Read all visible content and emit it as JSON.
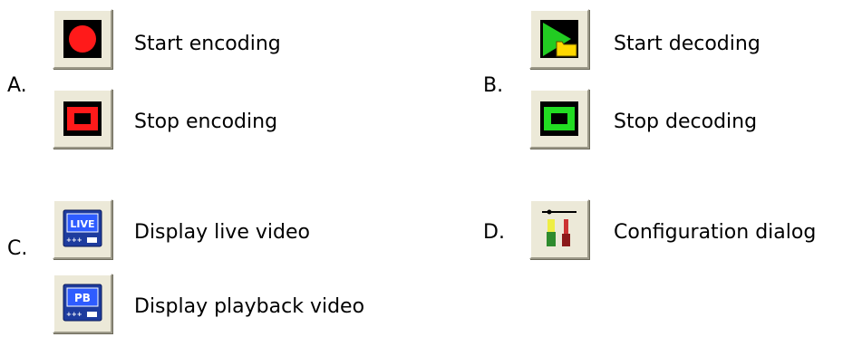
{
  "groups": [
    {
      "letter": "A.",
      "items": [
        {
          "label": "Start encoding",
          "icon": "record-icon"
        },
        {
          "label": "Stop encoding",
          "icon": "stop-encoding-icon"
        }
      ]
    },
    {
      "letter": "B.",
      "items": [
        {
          "label": "Start decoding",
          "icon": "play-folder-icon"
        },
        {
          "label": "Stop decoding",
          "icon": "stop-decoding-icon"
        }
      ]
    },
    {
      "letter": "C.",
      "items": [
        {
          "label": "Display live video",
          "icon": "live-icon",
          "badge": "LIVE"
        },
        {
          "label": "Display playback video",
          "icon": "playback-icon",
          "badge": "PB"
        }
      ]
    },
    {
      "letter": "D.",
      "items": [
        {
          "label": "Configuration dialog",
          "icon": "tools-icon"
        }
      ]
    }
  ]
}
